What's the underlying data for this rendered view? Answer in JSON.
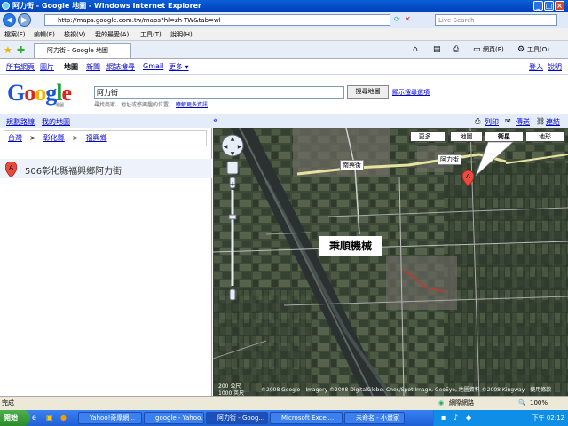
{
  "window": {
    "title": "阿力街 - Google 地圖 - Windows Internet Explorer"
  },
  "address_bar": {
    "url": "http://maps.google.com.tw/maps?hl=zh-TW&tab=wl",
    "search_placeholder": "Live Search"
  },
  "menu": {
    "items": [
      "檔案(F)",
      "編輯(E)",
      "檢視(V)",
      "我的最愛(A)",
      "工具(T)",
      "說明(H)"
    ]
  },
  "tab": {
    "label": "阿力街 - Google 地圖"
  },
  "browser_toolbar": {
    "page_label": "網頁(P)",
    "tools_label": "工具(O)"
  },
  "google_nav": {
    "links": [
      "所有網頁",
      "圖片",
      "地圖",
      "新聞",
      "網誌搜尋",
      "Gmail",
      "更多 ▾"
    ],
    "right_links": [
      "登入",
      "說明"
    ]
  },
  "search": {
    "logo_sub": "地圖",
    "query": "阿力街",
    "button": "搜尋地圖",
    "options_link": "顯示搜尋選項",
    "hint": "尋找商家、地址或感興趣的位置。",
    "hint_link": "瞭解更多資訊"
  },
  "action_bar": {
    "left_links": [
      "規劃路線",
      "我的地圖"
    ],
    "right_links": [
      "列印",
      "傳送",
      "連結"
    ],
    "collapse": "«"
  },
  "breadcrumb": {
    "items": [
      "台灣",
      "彰化縣",
      "福興鄉"
    ],
    "sep": ">"
  },
  "results": [
    {
      "marker": "A",
      "text": "506彰化縣福興鄉阿力街"
    }
  ],
  "map": {
    "types": [
      "更多...",
      "地圖",
      "衛星",
      "地形"
    ],
    "active_type": "衛星",
    "road_label": "南興街",
    "road_label2": "阿力街",
    "place_label": "秉順機械",
    "scale_label": "1000 英尺",
    "scale_label2": "200 公尺",
    "copyright": "©2008 Google - Imagery ©2008 DigitalGlobe, Cnes/Spot Image, GeoEye, 地圖資料 ©2008 Kingway - 使用條款"
  },
  "status": {
    "left": "完成",
    "zone": "網際網路",
    "zoom": "100%"
  },
  "taskbar": {
    "start": "開始",
    "tasks": [
      "Yahoo!奇摩網...",
      "google - Yahoo...",
      "阿力街 - Goog...",
      "Microsoft Excel...",
      "未命名 - 小畫家"
    ],
    "clock": "下午 02:12"
  },
  "colors": {
    "title_blue": "#0a5fd8",
    "link_blue": "#0000cc",
    "marker_red": "#e74c3c"
  }
}
